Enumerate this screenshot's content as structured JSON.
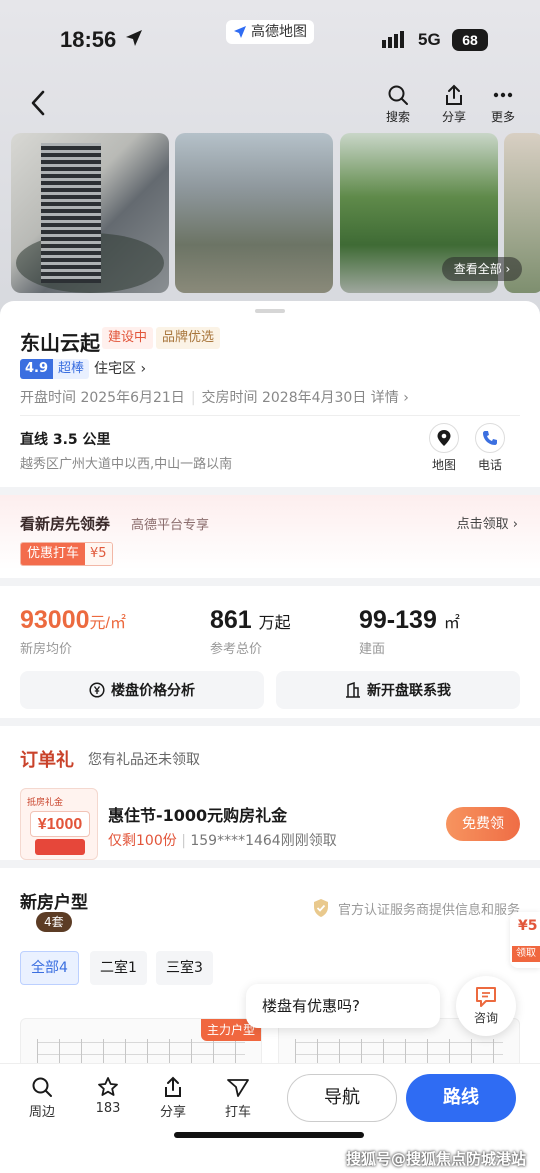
{
  "status": {
    "time": "18:56",
    "app_pill": "高德地图",
    "network": "5G",
    "battery": "68"
  },
  "topbar": {
    "search_label": "搜索",
    "share_label": "分享",
    "more_label": "更多",
    "view_all": "查看全部 ›"
  },
  "project": {
    "name": "东山云起",
    "tags": [
      "建设中",
      "品牌优选"
    ],
    "score": "4.9",
    "score_level": "超棒",
    "type": "住宅区 ›",
    "open_label": "开盘时间",
    "open_date": "2025年6月21日",
    "delivery_label": "交房时间",
    "delivery_date": "2028年4月30日",
    "details": "详情 ›",
    "distance": "直线 3.5 公里",
    "address": "越秀区广州大道中以西,中山一路以南",
    "map_label": "地图",
    "phone_label": "电话"
  },
  "coupon": {
    "title": "看新房先领券",
    "subtitle": "高德平台专享",
    "action": "点击领取 ›",
    "chip_label": "优惠打车",
    "chip_value": "¥5"
  },
  "pricing": {
    "avg_price": "93000",
    "avg_unit": "元/㎡",
    "avg_label": "新房均价",
    "total": "861",
    "total_unit": "万起",
    "total_label": "参考总价",
    "area": "99-139",
    "area_unit": "㎡",
    "area_label": "建面",
    "analysis_btn": "楼盘价格分析",
    "notify_btn": "新开盘联系我"
  },
  "gift": {
    "header": "订单礼",
    "subheader": "您有礼品还未领取",
    "badge_tag": "抵房礼金",
    "badge_value": "¥1000",
    "name": "惠住节-1000元购房礼金",
    "remaining": "仅剩100份",
    "recent": "159****1464刚刚领取",
    "claim": "免费领"
  },
  "floorplans": {
    "header": "新房户型",
    "count": "4套",
    "cert": "官方认证服务商提供信息和服务",
    "filters": [
      "全部4",
      "二室1",
      "三室3"
    ],
    "main_tag": "主力户型",
    "side_value": "¥5",
    "side_label": "领取"
  },
  "float": {
    "question": "楼盘有优惠吗?",
    "consult": "咨询"
  },
  "tabbar": {
    "nearby": "周边",
    "fav_count": "183",
    "share": "分享",
    "taxi": "打车",
    "navigate": "导航",
    "route": "路线"
  },
  "watermark": "搜狐号@搜狐焦点防城港站",
  "colors": {
    "accent_orange": "#ec6a3f",
    "accent_blue": "#2f6cf3",
    "tag_red": "#e2553a"
  }
}
